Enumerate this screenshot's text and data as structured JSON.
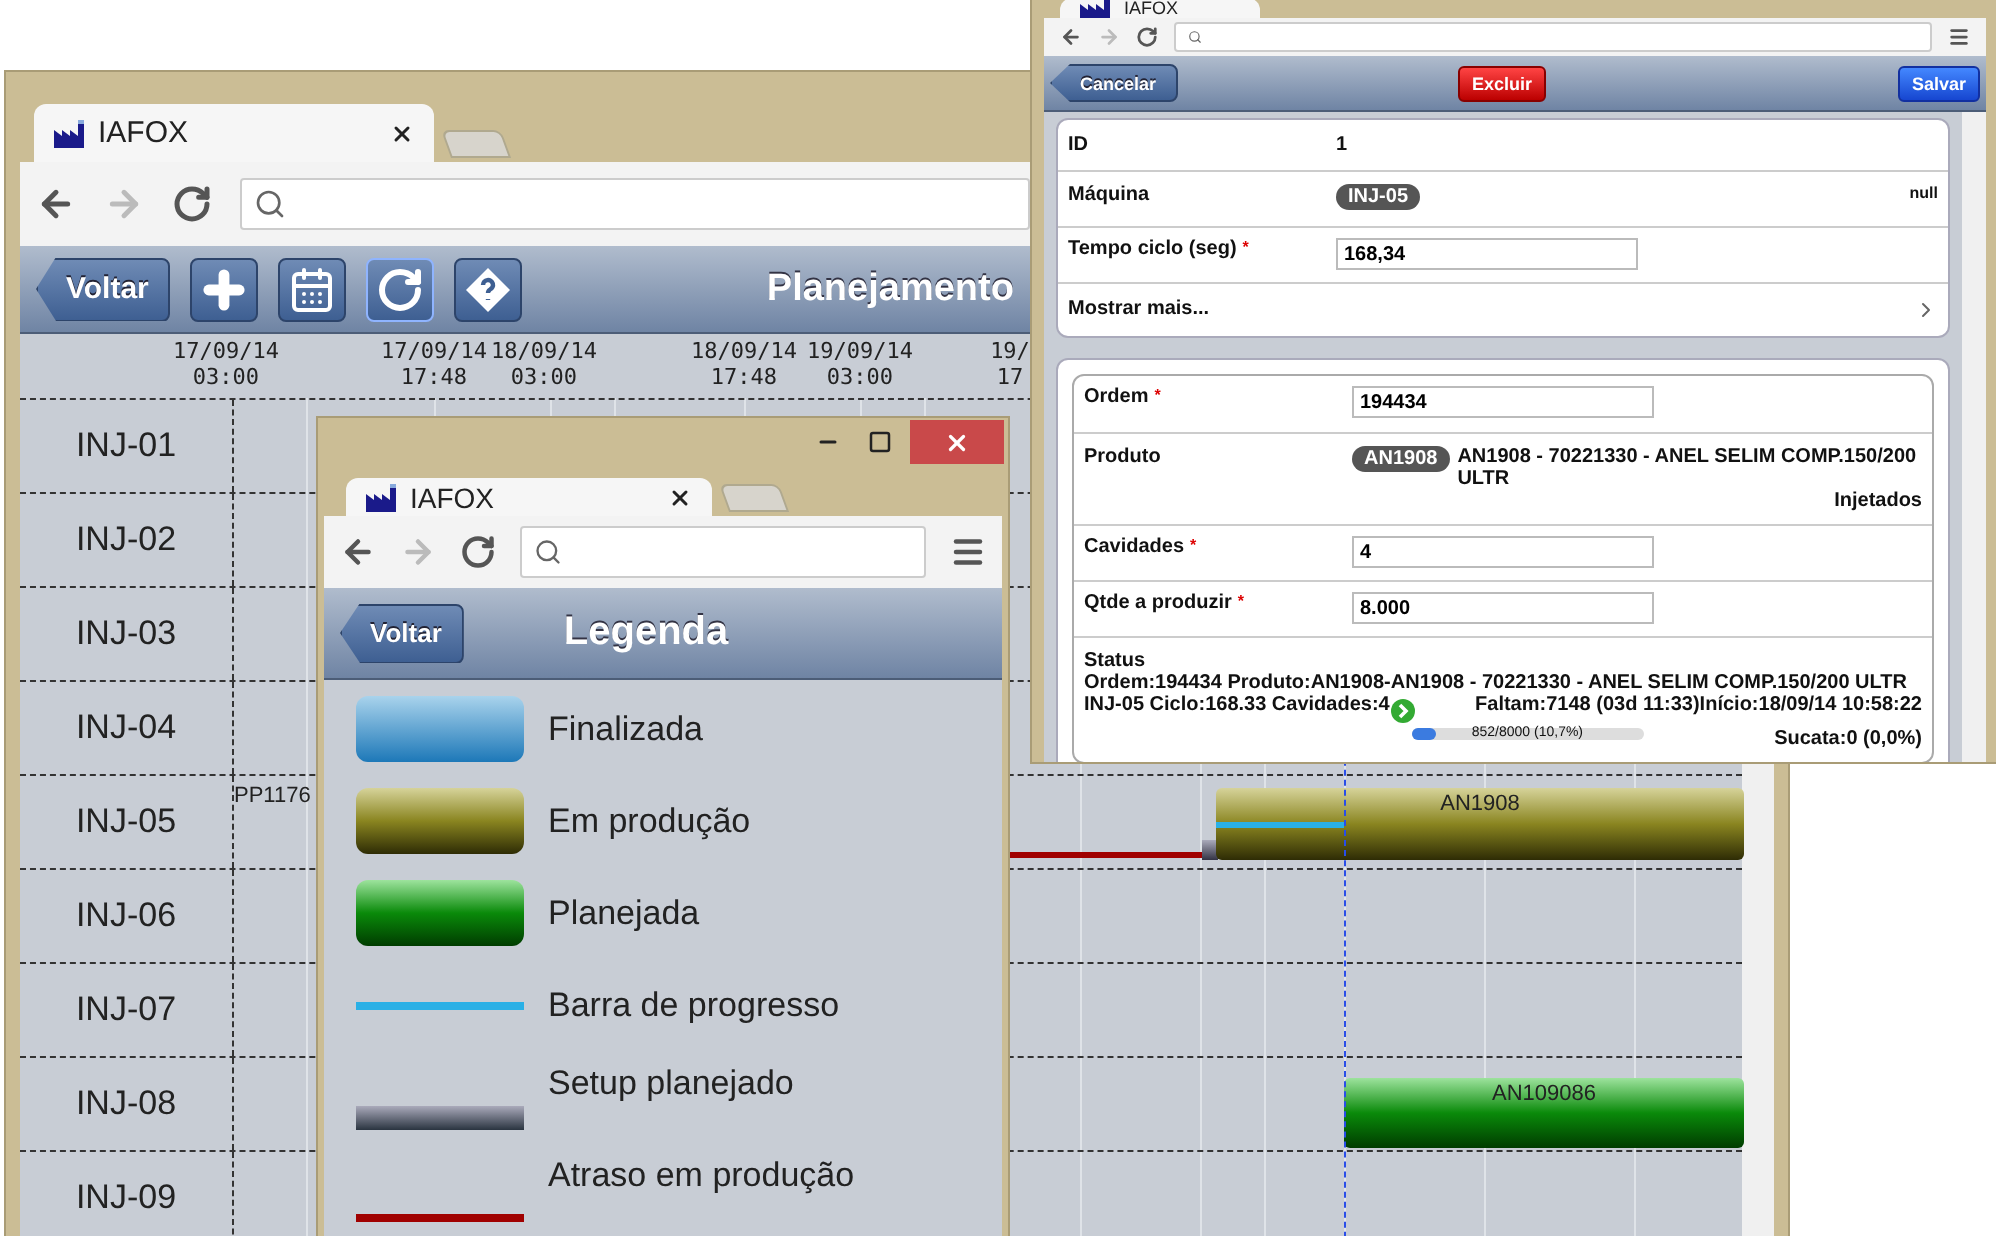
{
  "planning_window": {
    "tab_title": "IAFOX",
    "toolbar": {
      "back": "Voltar",
      "title": "Planejamento"
    },
    "timeline": [
      {
        "date": "17/09/14",
        "time": "03:00"
      },
      {
        "date": "17/09/14",
        "time": "17:48"
      },
      {
        "date": "18/09/14",
        "time": "03:00"
      },
      {
        "date": "18/09/14",
        "time": "17:48"
      },
      {
        "date": "19/09/14",
        "time": "03:00"
      },
      {
        "date": "19/",
        "time": "17"
      }
    ],
    "rows": [
      {
        "label": "INJ-01",
        "bars": []
      },
      {
        "label": "INJ-02",
        "bars": []
      },
      {
        "label": "INJ-03",
        "bars": []
      },
      {
        "label": "INJ-04",
        "bars": []
      },
      {
        "label": "INJ-05",
        "bars": [
          {
            "kind": "text",
            "label": "PP1176"
          },
          {
            "kind": "delay"
          },
          {
            "kind": "setup"
          },
          {
            "kind": "in_production",
            "label": "AN1908"
          },
          {
            "kind": "progress"
          }
        ]
      },
      {
        "label": "INJ-06",
        "bars": []
      },
      {
        "label": "INJ-07",
        "bars": []
      },
      {
        "label": "INJ-08",
        "bars": [
          {
            "kind": "planned",
            "label": "AN109086"
          }
        ]
      },
      {
        "label": "INJ-09",
        "bars": []
      }
    ]
  },
  "legend_window": {
    "tab_title": "IAFOX",
    "toolbar": {
      "back": "Voltar",
      "title": "Legenda"
    },
    "items": [
      {
        "kind": "finished",
        "label": "Finalizada"
      },
      {
        "kind": "in_production",
        "label": "Em produção"
      },
      {
        "kind": "planned",
        "label": "Planejada"
      },
      {
        "kind": "progress",
        "label": "Barra de progresso"
      },
      {
        "kind": "setup",
        "label": "Setup planejado"
      },
      {
        "kind": "delay",
        "label": "Atraso em produção"
      }
    ]
  },
  "edit_window": {
    "tab_title": "IAFOX",
    "toolbar": {
      "cancel": "Cancelar",
      "delete": "Excluir",
      "save": "Salvar"
    },
    "main_fields": [
      {
        "kind": "text",
        "label": "ID",
        "value": "1"
      },
      {
        "kind": "badge",
        "label": "Máquina",
        "badge": "INJ-05",
        "note": "null"
      },
      {
        "kind": "input",
        "label": "Tempo ciclo (seg)",
        "value": "168,34",
        "required_mark": "*"
      },
      {
        "kind": "link",
        "label": "Mostrar mais..."
      }
    ],
    "order_fields": [
      {
        "kind": "input",
        "label": "Ordem",
        "value": "194434",
        "required_mark": "*"
      },
      {
        "kind": "badge",
        "label": "Produto",
        "badge": "AN1908",
        "value": "AN1908 - 70221330 - ANEL SELIM COMP.150/200 ULTR",
        "note": "Injetados"
      },
      {
        "kind": "input",
        "label": "Cavidades",
        "value": "4",
        "required_mark": "*"
      },
      {
        "kind": "input",
        "label": "Qtde a produzir",
        "value": "8.000",
        "required_mark": "*"
      }
    ],
    "status": {
      "label": "Status",
      "line_1": "Ordem:194434 Produto:AN1908-AN1908 - 70221330 - ANEL SELIM COMP.150/200 ULTR",
      "line_2": "INJ-05 Ciclo:168.33 Cavidades:4",
      "remaining": "Faltam:7148 (03d 11:33)Início:18/09/14 10:58:22",
      "level": 0.107,
      "progress_text": "852/8000 (10,7%)",
      "scrap": "Sucata:0 (0,0%)"
    }
  }
}
